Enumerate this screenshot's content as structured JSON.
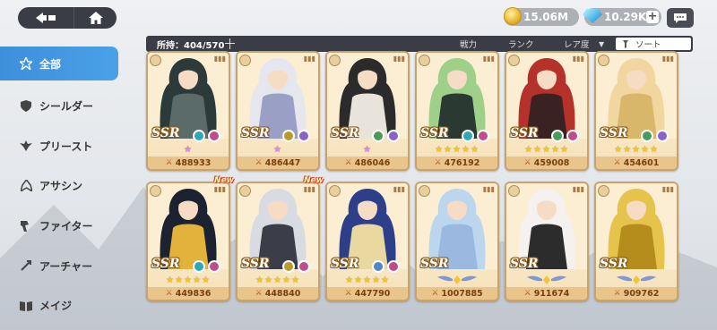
{
  "header": {
    "gold": "15.06M",
    "gems": "10.29K",
    "gem_plus": "+"
  },
  "sidebar": {
    "items": [
      {
        "label": "全部",
        "icon": "all-icon",
        "active": true
      },
      {
        "label": "シールダー",
        "icon": "shield-icon",
        "active": false
      },
      {
        "label": "プリースト",
        "icon": "priest-icon",
        "active": false
      },
      {
        "label": "アサシン",
        "icon": "assassin-icon",
        "active": false
      },
      {
        "label": "ファイター",
        "icon": "fighter-icon",
        "active": false
      },
      {
        "label": "アーチャー",
        "icon": "archer-icon",
        "active": false
      },
      {
        "label": "メイジ",
        "icon": "mage-icon",
        "active": false
      }
    ]
  },
  "filter": {
    "owned": "所持：404/570",
    "sort_power": "戦力",
    "sort_rank": "ランク",
    "sort_rarity": "レア度",
    "sort_button": "ソート"
  },
  "cards": [
    {
      "power": "488933",
      "rarity": "SSR",
      "stars": "★",
      "star_color": "pink",
      "new": false,
      "colors": [
        "#2c3a3a",
        "#5b6b6a"
      ],
      "elements": [
        "#2ea8b6",
        "#c04d8a"
      ]
    },
    {
      "power": "486447",
      "rarity": "SSR",
      "stars": "★",
      "star_color": "pink",
      "new": false,
      "colors": [
        "#e6e6ef",
        "#9aa0c5"
      ],
      "elements": [
        "#b89b2a",
        "#8b62c8"
      ]
    },
    {
      "power": "486046",
      "rarity": "SSR",
      "stars": "★",
      "star_color": "pink",
      "new": false,
      "colors": [
        "#2b2b2b",
        "#e8e4dc"
      ],
      "elements": [
        "#4a9a5a",
        "#8b62c8"
      ]
    },
    {
      "power": "476192",
      "rarity": "SSR",
      "stars": "★★★★★",
      "star_color": "gold",
      "new": false,
      "colors": [
        "#9fd08a",
        "#2a3a33"
      ],
      "elements": [
        "#2ea8b6",
        "#c04d8a"
      ]
    },
    {
      "power": "459008",
      "rarity": "SSR",
      "stars": "★★★★★",
      "star_color": "gold",
      "new": false,
      "colors": [
        "#b4322a",
        "#3a2222"
      ],
      "elements": [
        "#4a9a5a",
        "#c04d8a"
      ]
    },
    {
      "power": "454601",
      "rarity": "SSR",
      "stars": "★★★★★",
      "star_color": "gold",
      "new": false,
      "colors": [
        "#f2d6a0",
        "#d8b66a"
      ],
      "elements": [
        "#4a9a5a",
        "#8b62c8"
      ]
    },
    {
      "power": "449836",
      "rarity": "SSR",
      "stars": "★★★★★",
      "star_color": "gold",
      "new": true,
      "new_label": "New",
      "colors": [
        "#1d2230",
        "#e2b23a"
      ],
      "elements": [
        "#2ea8b6",
        "#c04d8a"
      ]
    },
    {
      "power": "448840",
      "rarity": "SSR",
      "stars": "★★★★★",
      "star_color": "gold",
      "new": true,
      "new_label": "New",
      "colors": [
        "#d9dbe3",
        "#3b3e48"
      ],
      "elements": [
        "#b89b2a",
        "#c04d8a"
      ]
    },
    {
      "power": "447790",
      "rarity": "SSR",
      "stars": "★★★★★",
      "star_color": "gold",
      "new": false,
      "colors": [
        "#2e3f8a",
        "#e9d9a0"
      ],
      "elements": [
        "#4f86c6",
        "#c04d8a"
      ]
    },
    {
      "power": "1007885",
      "rarity": "SSR",
      "stars": "",
      "star_color": "wings",
      "new": false,
      "colors": [
        "#bcd6ee",
        "#9ab8e0"
      ],
      "elements": []
    },
    {
      "power": "911674",
      "rarity": "SSR",
      "stars": "",
      "star_color": "wings",
      "new": false,
      "colors": [
        "#f4f1ee",
        "#2c2c2c"
      ],
      "elements": []
    },
    {
      "power": "909762",
      "rarity": "SSR",
      "stars": "",
      "star_color": "wings",
      "new": false,
      "colors": [
        "#e6c34a",
        "#b58d1c"
      ],
      "elements": []
    }
  ],
  "colors": {
    "accent_blue": "#3d8fd9",
    "card_border": "#c8a36b",
    "dark_bar": "#3a3d45"
  }
}
